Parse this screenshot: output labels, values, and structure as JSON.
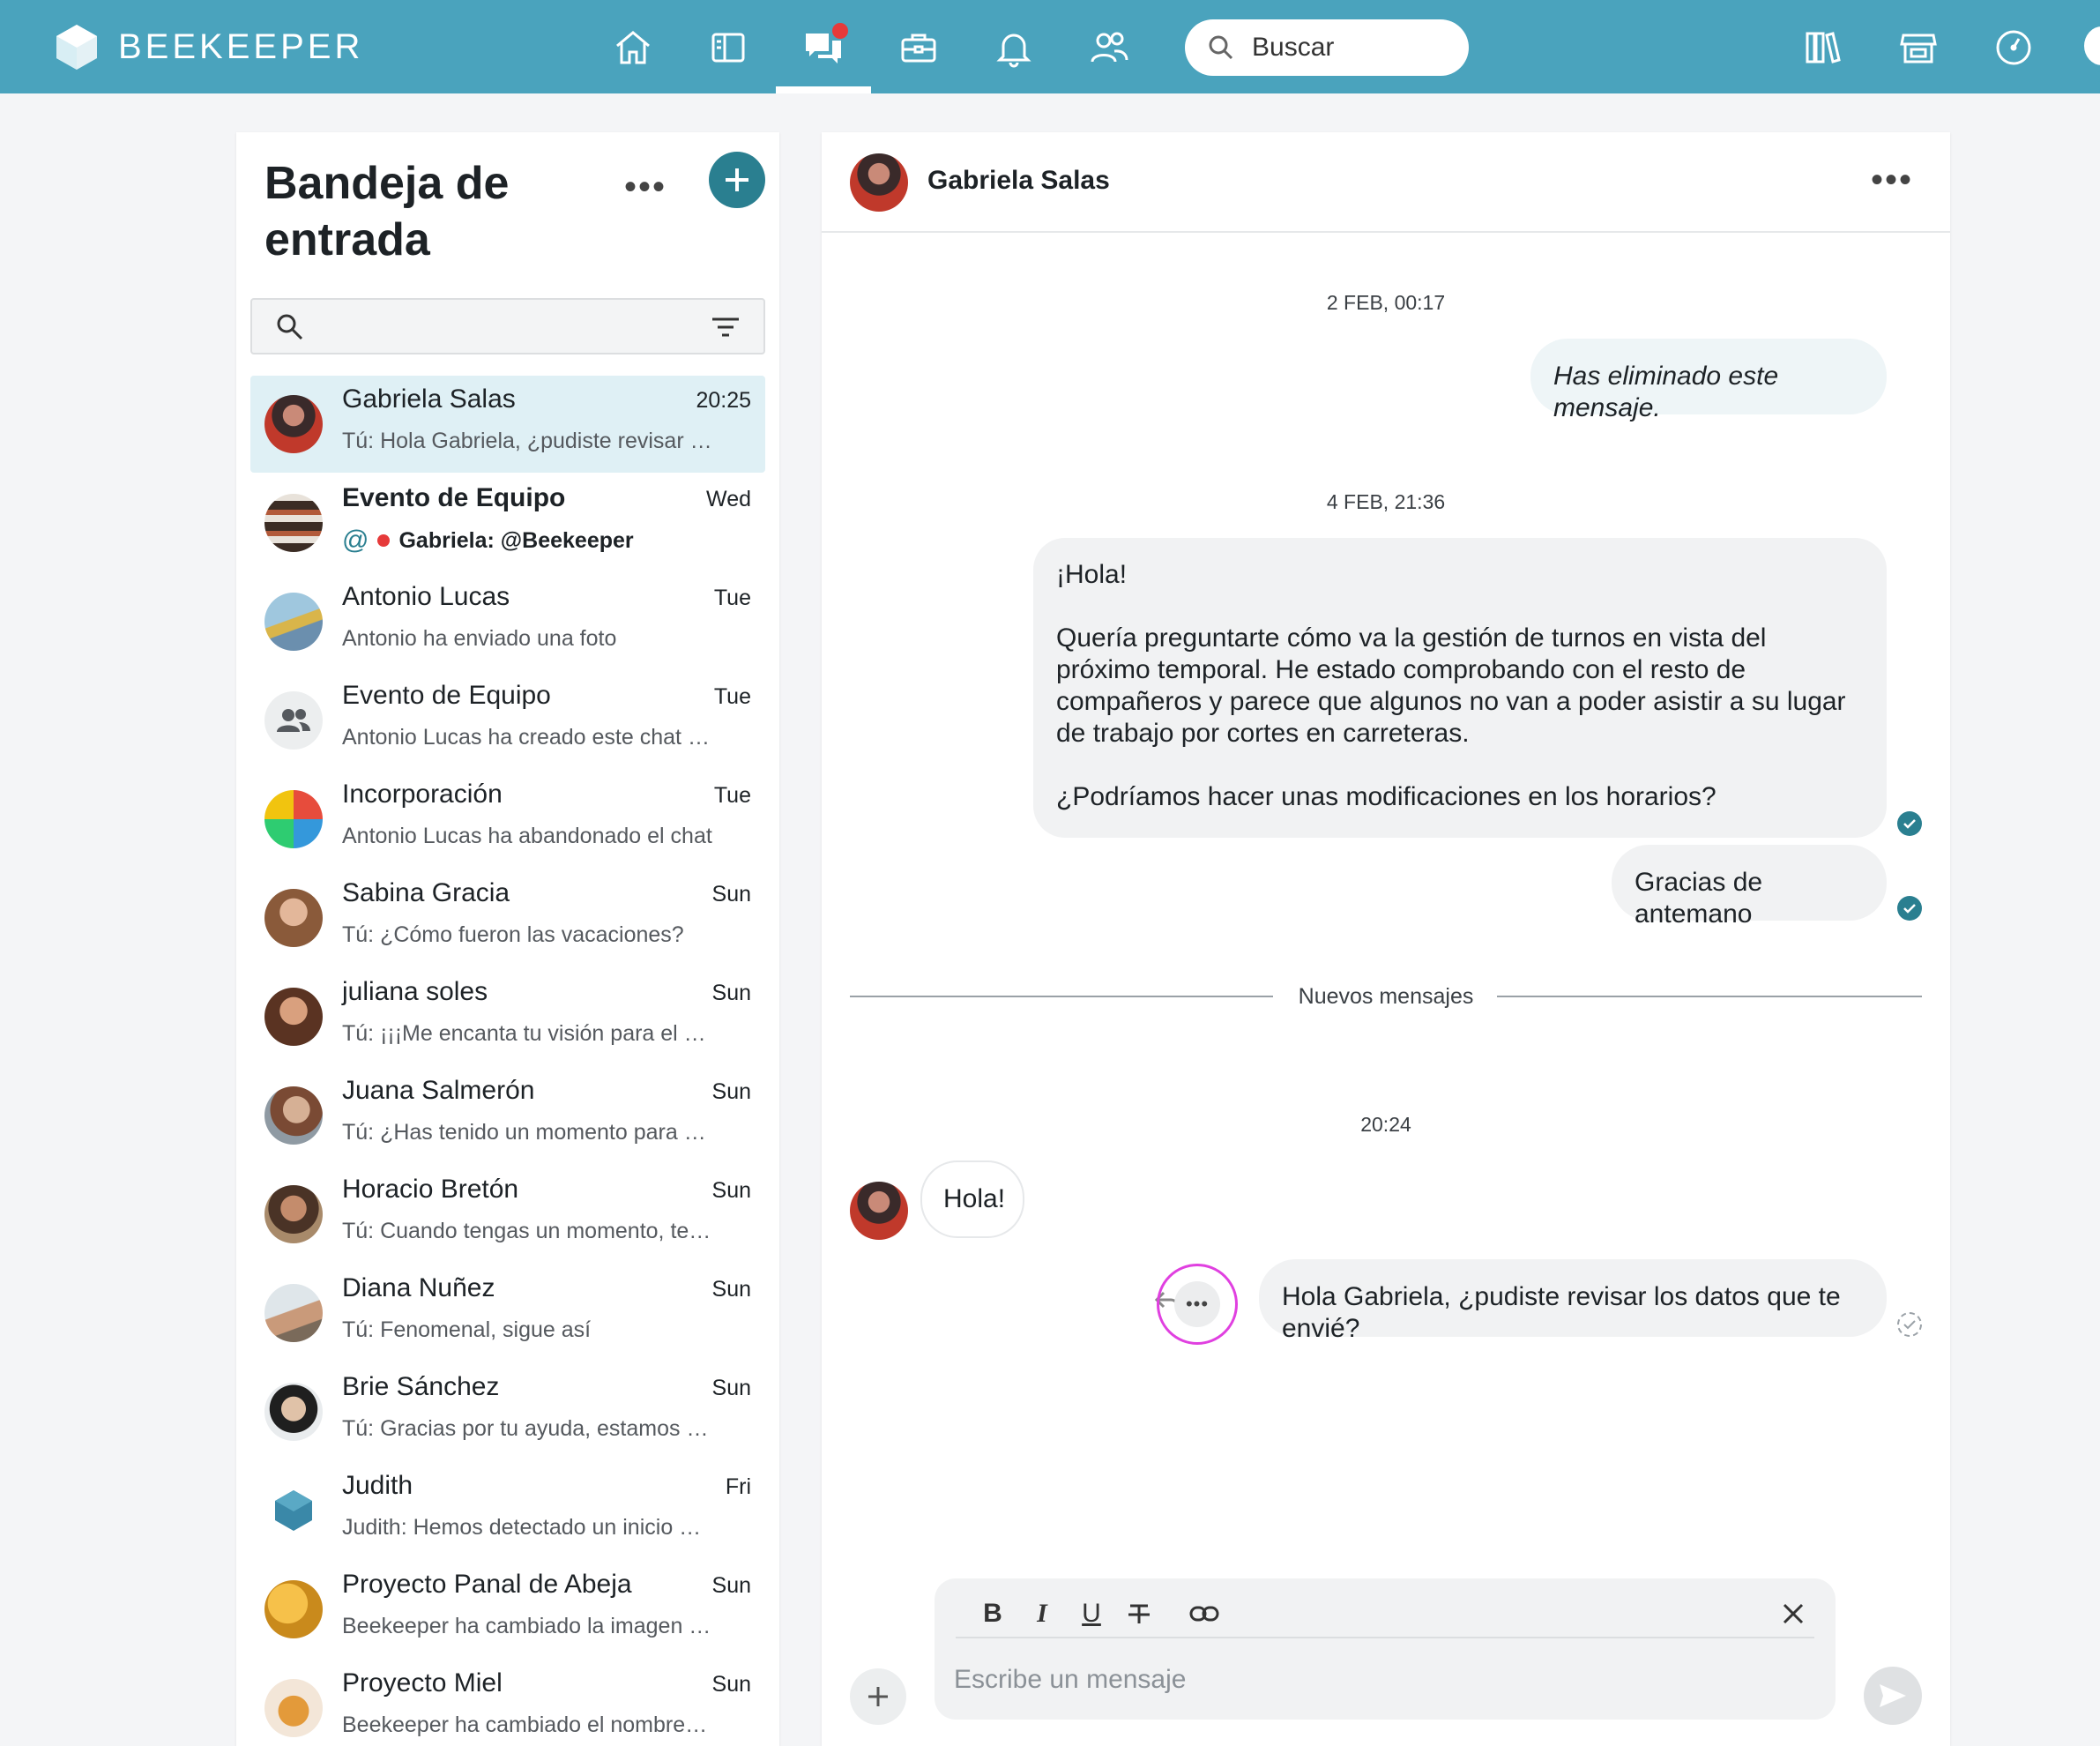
{
  "app": {
    "brand": "BEEKEEPER"
  },
  "search": {
    "placeholder": "Buscar"
  },
  "inbox": {
    "title": "Bandeja de entrada",
    "more": "•••",
    "conversations": [
      {
        "name": "Gabriela Salas",
        "time": "20:25",
        "preview": "Tú: Hola Gabriela, ¿pudiste revisar l…",
        "active": true
      },
      {
        "name": "Evento de Equipo",
        "time": "Wed",
        "preview": "Gabriela: @Beekeeper",
        "unread": true
      },
      {
        "name": "Antonio Lucas",
        "time": "Tue",
        "preview": "Antonio ha enviado una foto"
      },
      {
        "name": "Evento de Equipo",
        "time": "Tue",
        "preview": "Antonio Lucas ha creado este chat d…"
      },
      {
        "name": "Incorporación",
        "time": "Tue",
        "preview": "Antonio Lucas ha abandonado el chat"
      },
      {
        "name": "Sabina Gracia",
        "time": "Sun",
        "preview": "Tú: ¿Cómo fueron las vacaciones?"
      },
      {
        "name": "juliana soles",
        "time": "Sun",
        "preview": "Tú: ¡¡¡Me encanta tu visión para el pr…"
      },
      {
        "name": "Juana Salmerón",
        "time": "Sun",
        "preview": "Tú: ¿Has tenido un momento para …"
      },
      {
        "name": "Horacio Bretón",
        "time": "Sun",
        "preview": "Tú: Cuando tengas un momento, te…"
      },
      {
        "name": "Diana Nuñez",
        "time": "Sun",
        "preview": "Tú: Fenomenal, sigue así"
      },
      {
        "name": "Brie Sánchez",
        "time": "Sun",
        "preview": "Tú: Gracias por tu ayuda, estamos e…"
      },
      {
        "name": "Judith",
        "time": "Fri",
        "preview": "Judith: Hemos detectado un inicio d…"
      },
      {
        "name": "Proyecto Panal de Abeja",
        "time": "Sun",
        "preview": "Beekeeper ha cambiado la imagen …"
      },
      {
        "name": "Proyecto Miel",
        "time": "Sun",
        "preview": "Beekeeper ha cambiado el nombre …"
      }
    ]
  },
  "chat": {
    "title": "Gabriela Salas",
    "more": "•••",
    "date1": "2 FEB, 00:17",
    "deleted_msg": "Has eliminado este mensaje.",
    "date2": "4 FEB, 21:36",
    "long_msg_p1": "¡Hola!",
    "long_msg_p2": "Quería preguntarte cómo va la gestión de turnos en vista del próximo temporal. He estado comprobando con el resto de compañeros y parece que algunos no van a poder asistir a su lugar de trabajo por cortes en carreteras.",
    "long_msg_p3": "¿Podríamos hacer unas modificaciones en los horarios?",
    "thanks_msg": "Gracias de antemano",
    "new_messages": "Nuevos mensajes",
    "date3": "20:24",
    "incoming_msg": "Hola!",
    "outgoing_msg": "Hola Gabriela, ¿pudiste revisar los datos que te envié?",
    "actions": "•••"
  },
  "composer": {
    "placeholder": "Escribe un mensaje",
    "bold": "B",
    "italic": "I",
    "underline": "U"
  },
  "colors": {
    "topbar": "#4aa3bd",
    "accent": "#2a7f90",
    "highlight_ring": "#e040e0"
  }
}
